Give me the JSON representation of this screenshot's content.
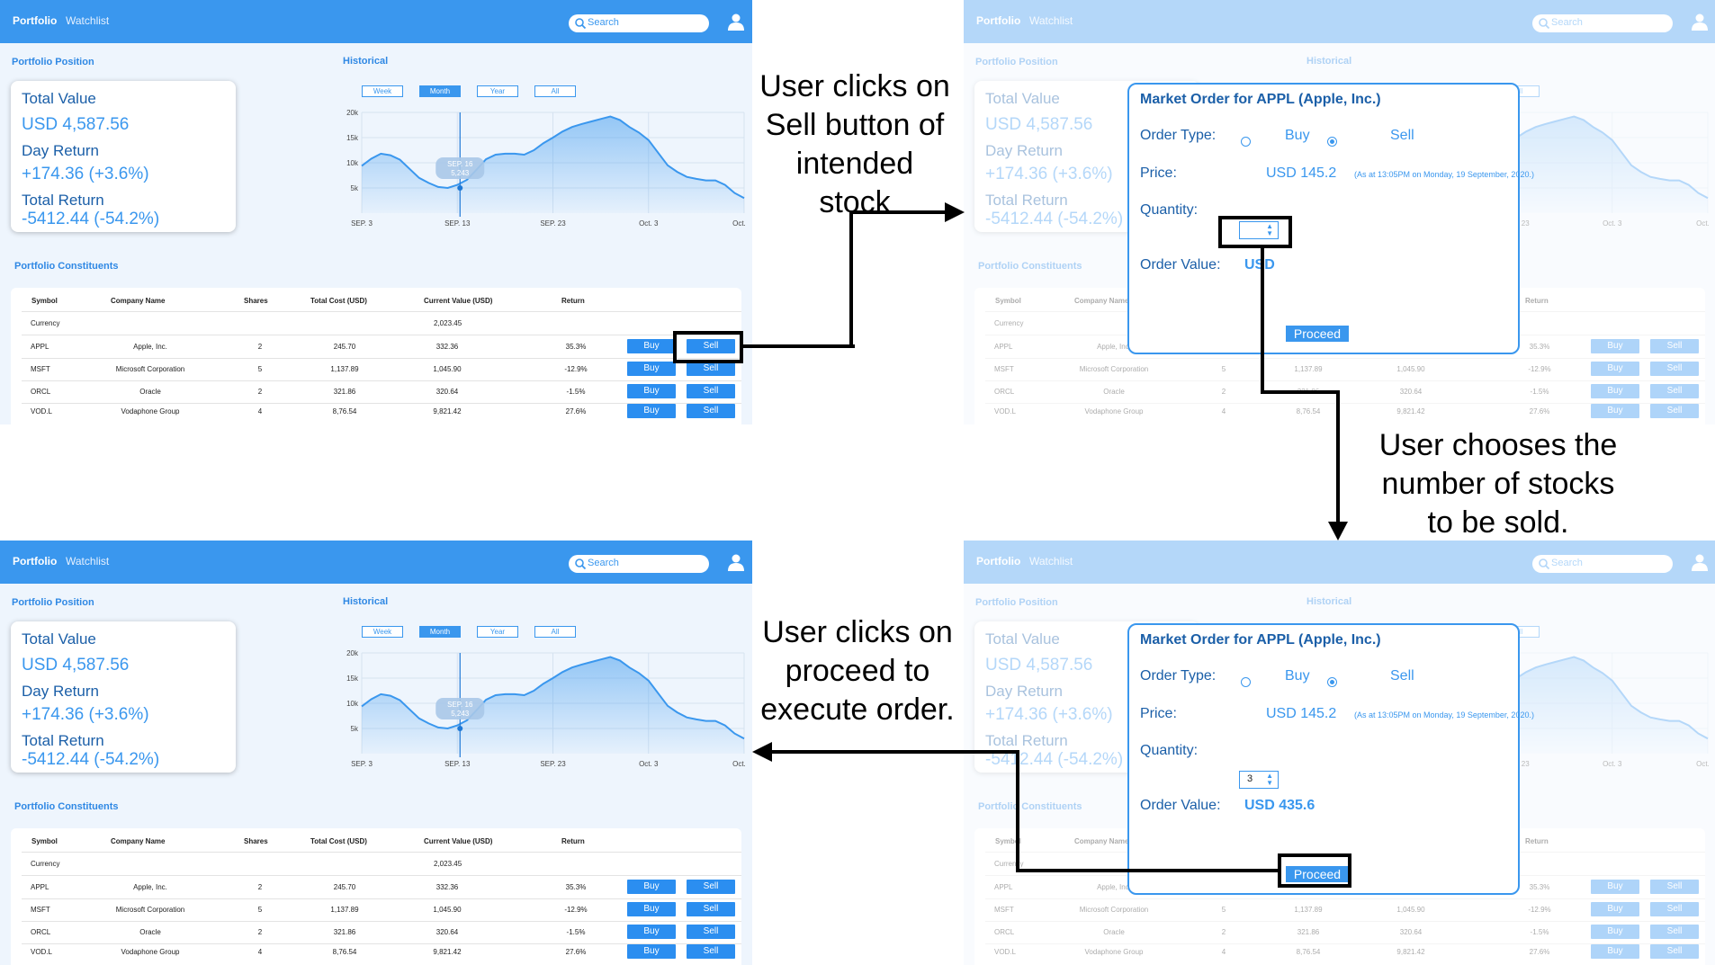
{
  "app": {
    "nav": {
      "portfolio": "Portfolio",
      "watchlist": "Watchlist"
    },
    "search_placeholder": "Search",
    "sections": {
      "position": "Portfolio Position",
      "historical": "Historical",
      "constituents": "Portfolio Constituents"
    },
    "summary": {
      "total_value_label": "Total Value",
      "total_value": "USD 4,587.56",
      "day_return_label": "Day Return",
      "day_return": "+174.36 (+3.6%)",
      "total_return_label": "Total Return",
      "total_return": "-5412.44 (-54.2%)"
    },
    "ranges": [
      "Week",
      "Month",
      "Year",
      "All"
    ],
    "active_range": "Month",
    "table": {
      "headers": [
        "Symbol",
        "Company Name",
        "Shares",
        "Total Cost (USD)",
        "Current Value (USD)",
        "Return"
      ],
      "currency_row": {
        "label": "Currency",
        "value": "2,023.45"
      },
      "rows": [
        {
          "symbol": "APPL",
          "company": "Apple, Inc.",
          "shares": "2",
          "cost": "245.70",
          "value": "332.36",
          "ret": "35.3%"
        },
        {
          "symbol": "MSFT",
          "company": "Microsoft Corporation",
          "shares": "5",
          "cost": "1,137.89",
          "value": "1,045.90",
          "ret": "-12.9%"
        },
        {
          "symbol": "ORCL",
          "company": "Oracle",
          "shares": "2",
          "cost": "321.86",
          "value": "320.64",
          "ret": "-1.5%"
        },
        {
          "symbol": "VOD.L",
          "company": "Vodaphone Group",
          "shares": "4",
          "cost": "8,76.54",
          "value": "9,821.42",
          "ret": "27.6%"
        }
      ],
      "buy_label": "Buy",
      "sell_label": "Sell"
    }
  },
  "chart_data": {
    "type": "area",
    "x_ticks": [
      "SEP. 3",
      "SEP. 13",
      "SEP. 23",
      "Oct. 3",
      "Oct. 13"
    ],
    "y_ticks": [
      "20k",
      "15k",
      "10k",
      "5k"
    ],
    "ylim": [
      0,
      20000
    ],
    "x": [
      0,
      1,
      2,
      3,
      4,
      5,
      6,
      7,
      8,
      9,
      10,
      11,
      12,
      13,
      14,
      15,
      16,
      17,
      18,
      19,
      20,
      21,
      22,
      23,
      24,
      25,
      26,
      27,
      28,
      29,
      30,
      31,
      32,
      33,
      34,
      35,
      36,
      37,
      38,
      39,
      40
    ],
    "values": [
      9400,
      10800,
      11800,
      11500,
      10600,
      8800,
      7000,
      6000,
      5200,
      5000,
      5600,
      6600,
      8600,
      10700,
      11600,
      11800,
      11800,
      11600,
      12500,
      13900,
      15000,
      16200,
      17100,
      17700,
      18200,
      18700,
      19200,
      18500,
      17100,
      16000,
      14500,
      12000,
      9500,
      8200,
      7200,
      6800,
      6500,
      6500,
      5600,
      4000,
      3000
    ],
    "tooltip": {
      "label": "SEP. 16",
      "value": "5,243"
    }
  },
  "dialog": {
    "title": "Market Order for APPL (Apple, Inc.)",
    "order_type_label": "Order Type:",
    "buy": "Buy",
    "sell": "Sell",
    "price_label": "Price:",
    "price": "USD 145.2",
    "as_at": "(As at 13:05PM on Monday, 19 September, 2020.)",
    "quantity_label": "Quantity:",
    "order_value_label": "Order Value:",
    "order_value_empty": "USD",
    "quantity_filled": "3",
    "order_value_filled": "USD 435.6",
    "proceed": "Proceed"
  },
  "annotations": {
    "step1": "User clicks on\nSell button of\nintended\nstock",
    "step2": "User chooses the\nnumber of stocks\nto be sold.",
    "step3": "User clicks on\nproceed to\nexecute order."
  }
}
